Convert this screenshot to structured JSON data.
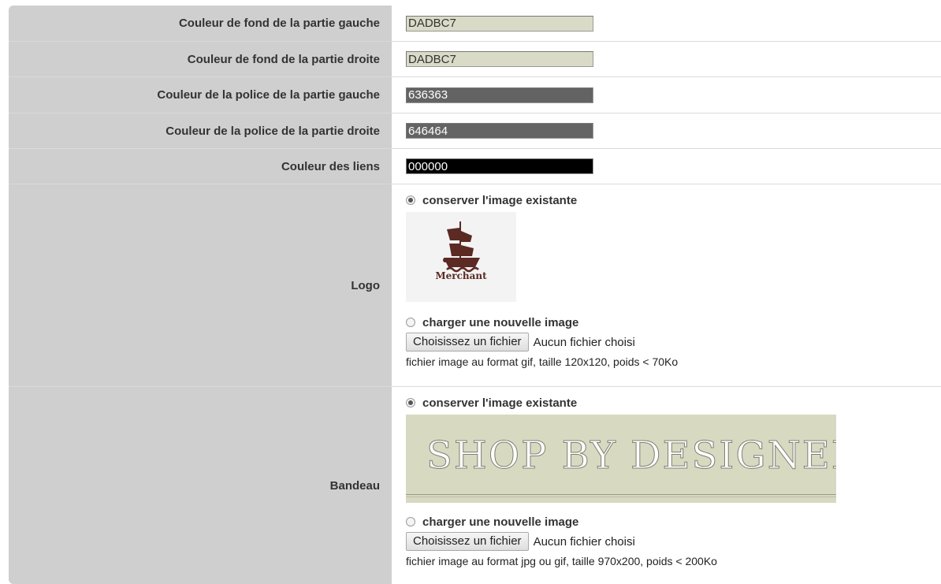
{
  "rows": [
    {
      "label": "Couleur de fond de la partie gauche",
      "value": "DADBC7",
      "bg": "#DADBC7",
      "fg": "#333333"
    },
    {
      "label": "Couleur de fond de la partie droite",
      "value": "DADBC7",
      "bg": "#DADBC7",
      "fg": "#333333"
    },
    {
      "label": "Couleur de la police de la partie gauche",
      "value": "636363",
      "bg": "#636363",
      "fg": "#ffffff"
    },
    {
      "label": "Couleur de la police de la partie droite",
      "value": "646464",
      "bg": "#646464",
      "fg": "#ffffff"
    },
    {
      "label": "Couleur des liens",
      "value": "000000",
      "bg": "#000000",
      "fg": "#ffffff"
    }
  ],
  "logo": {
    "label": "Logo",
    "keep_option": "conserver l'image existante",
    "image_text": "Merchant",
    "new_option": "charger une nouvelle image",
    "file_button": "Choisissez un fichier",
    "file_status": "Aucun fichier choisi",
    "hint": "fichier image au format gif, taille 120x120, poids < 70Ko"
  },
  "bandeau": {
    "label": "Bandeau",
    "keep_option": "conserver l'image existante",
    "image_text": "SHOP BY DESIGNER",
    "new_option": "charger une nouvelle image",
    "file_button": "Choisissez un fichier",
    "file_status": "Aucun fichier choisi",
    "hint": "fichier image au format jpg ou gif, taille 970x200, poids < 200Ko"
  },
  "colors": {
    "label_bg": "#cfcfcf",
    "ship": "#5b2a22"
  }
}
